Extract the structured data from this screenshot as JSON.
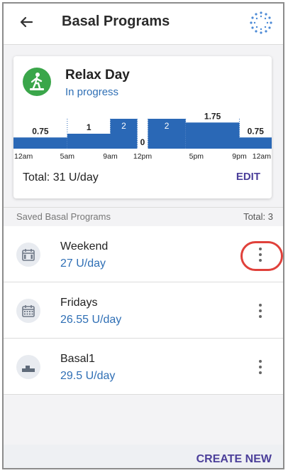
{
  "header": {
    "title": "Basal Programs",
    "back_icon": "back-arrow-icon",
    "status_icon": "sync-spinner-icon"
  },
  "active_program": {
    "name": "Relax Day",
    "status": "In progress",
    "icon": "person-relaxing-icon",
    "total_label": "Total: 31 U/day",
    "edit_label": "EDIT",
    "accent_color": "#2f6fb5"
  },
  "chart_data": {
    "type": "bar",
    "x_ticks": [
      "12am",
      "5am",
      "9am",
      "12pm",
      "5pm",
      "9pm",
      "12am"
    ],
    "segments": [
      {
        "start_hour": 0,
        "end_hour": 5,
        "value": 0.75,
        "label": "0.75"
      },
      {
        "start_hour": 5,
        "end_hour": 9,
        "value": 1,
        "label": "1"
      },
      {
        "start_hour": 9,
        "end_hour": 11.5,
        "value": 2,
        "label": "2"
      },
      {
        "start_hour": 11.5,
        "end_hour": 12.5,
        "value": 0,
        "label": "0"
      },
      {
        "start_hour": 12.5,
        "end_hour": 16,
        "value": 2,
        "label": "2"
      },
      {
        "start_hour": 16,
        "end_hour": 21,
        "value": 1.75,
        "label": "1.75"
      },
      {
        "start_hour": 21,
        "end_hour": 24,
        "value": 0.75,
        "label": "0.75"
      }
    ],
    "ylim": [
      0,
      2
    ],
    "bar_color": "#2a68b6"
  },
  "saved": {
    "title": "Saved Basal Programs",
    "total": "Total: 3",
    "items": [
      {
        "name": "Weekend",
        "rate": "27 U/day",
        "icon": "calendar-weekend-icon"
      },
      {
        "name": "Fridays",
        "rate": "26.55 U/day",
        "icon": "calendar-icon"
      },
      {
        "name": "Basal1",
        "rate": "29.5 U/day",
        "icon": "basal-steps-icon"
      }
    ]
  },
  "footer": {
    "create_label": "CREATE NEW"
  }
}
